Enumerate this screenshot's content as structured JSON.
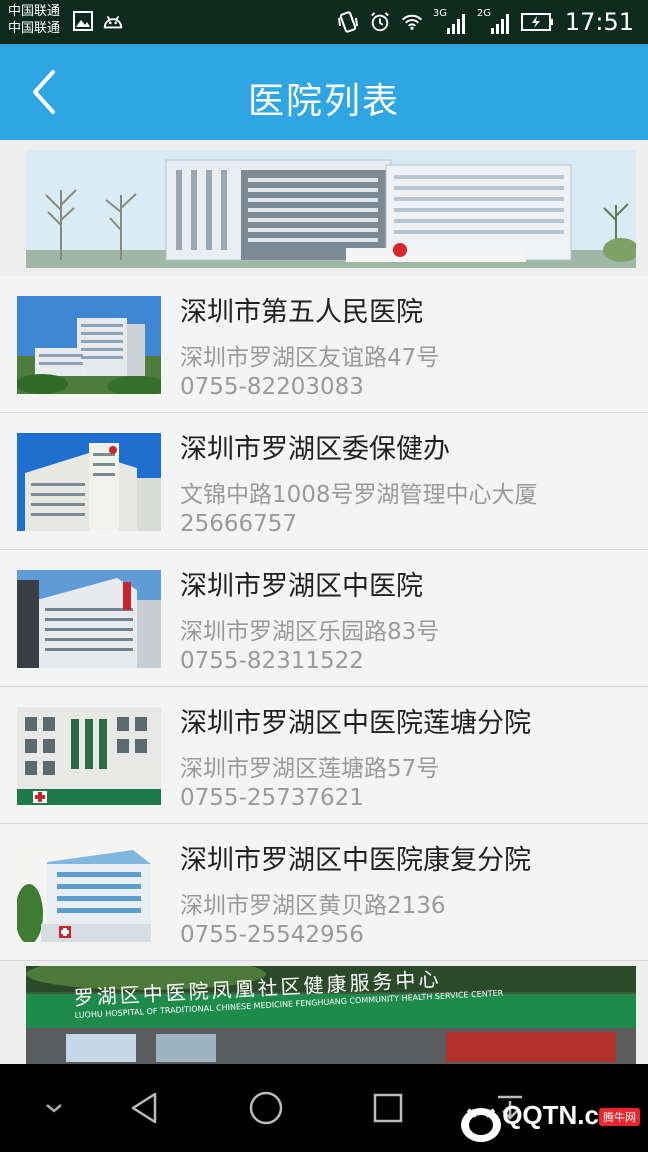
{
  "status_bar": {
    "carrier_1": "中国联通",
    "carrier_2": "中国联通",
    "net_1": "3G",
    "net_2": "2G",
    "time": "17:51"
  },
  "header": {
    "title": "医院列表",
    "back_icon": "chevron-left-icon"
  },
  "hospitals": [
    {
      "name": "深圳市第五人民医院",
      "address": "深圳市罗湖区友谊路47号",
      "phone": "0755-82203083"
    },
    {
      "name": "深圳市罗湖区委保健办",
      "address": "文锦中路1008号罗湖管理中心大厦",
      "phone": "25666757"
    },
    {
      "name": "深圳市罗湖区中医院",
      "address": "深圳市罗湖区乐园路83号",
      "phone": "0755-82311522"
    },
    {
      "name": "深圳市罗湖区中医院莲塘分院",
      "address": "深圳市罗湖区莲塘路57号",
      "phone": "0755-25737621"
    },
    {
      "name": "深圳市罗湖区中医院康复分院",
      "address": "深圳市罗湖区黄贝路2136",
      "phone": "0755-25542956"
    }
  ],
  "bottom_photo": {
    "sign_text": "罗湖区中医院凤凰社区健康服务中心",
    "sign_subtext": "LUOHU HOSPITAL OF TRADITIONAL CHINESE MEDICINE FENGHUANG COMMUNITY HEALTH SERVICE CENTER"
  },
  "nav": {
    "icons": [
      "chevron-down-icon",
      "back-triangle-icon",
      "home-circle-icon",
      "recents-square-icon",
      "download-icon"
    ]
  },
  "watermark": {
    "text": "QQTN.com",
    "tag": "腾牛网"
  },
  "colors": {
    "header": "#2fa6e3",
    "status_bar": "#0d2a1f",
    "nav_bar": "#000000"
  }
}
